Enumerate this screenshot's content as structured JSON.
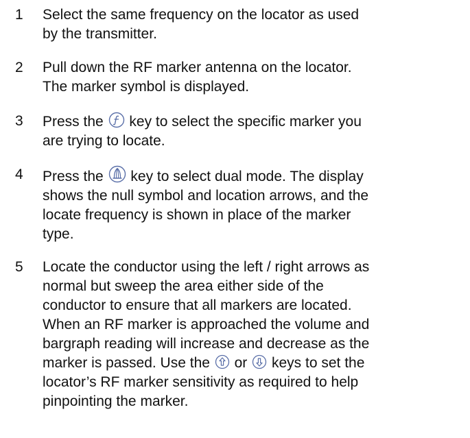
{
  "steps": [
    {
      "number": "1",
      "lines": [
        "Select the same frequency on the locator as used",
        "by the transmitter."
      ]
    },
    {
      "number": "2",
      "lines": [
        "Pull down the RF marker antenna on the locator.",
        "The marker symbol is displayed."
      ]
    },
    {
      "number": "3",
      "line1_before": "Press the",
      "line1_after": "key to select the specific marker you",
      "line2": "are trying to locate."
    },
    {
      "number": "4",
      "line1_before": "Press the",
      "line1_after": "key to select dual mode. The display",
      "lines_rest": [
        "shows the null symbol and location arrows, and the",
        "locate frequency is shown in place of the marker",
        "type."
      ]
    },
    {
      "number": "5",
      "lines_before": [
        "Locate the conductor using the left / right arrows as",
        "normal but sweep the area either side of the",
        "conductor to ensure that all markers are located.",
        "When an RF marker is approached the volume and",
        "bargraph reading will increase and decrease as the"
      ],
      "icon_line_a": "marker is passed. Use the",
      "icon_line_b": "or",
      "icon_line_c": "keys to set the",
      "lines_after": [
        "locator’s RF marker sensitivity as required to help",
        "pinpointing the marker."
      ]
    }
  ],
  "icons": {
    "function_key": "function-key-icon",
    "antenna_key": "antenna-mode-key-icon",
    "up_key": "up-arrow-key-icon",
    "down_key": "down-arrow-key-icon",
    "icon_color": "#5a6fa8"
  }
}
